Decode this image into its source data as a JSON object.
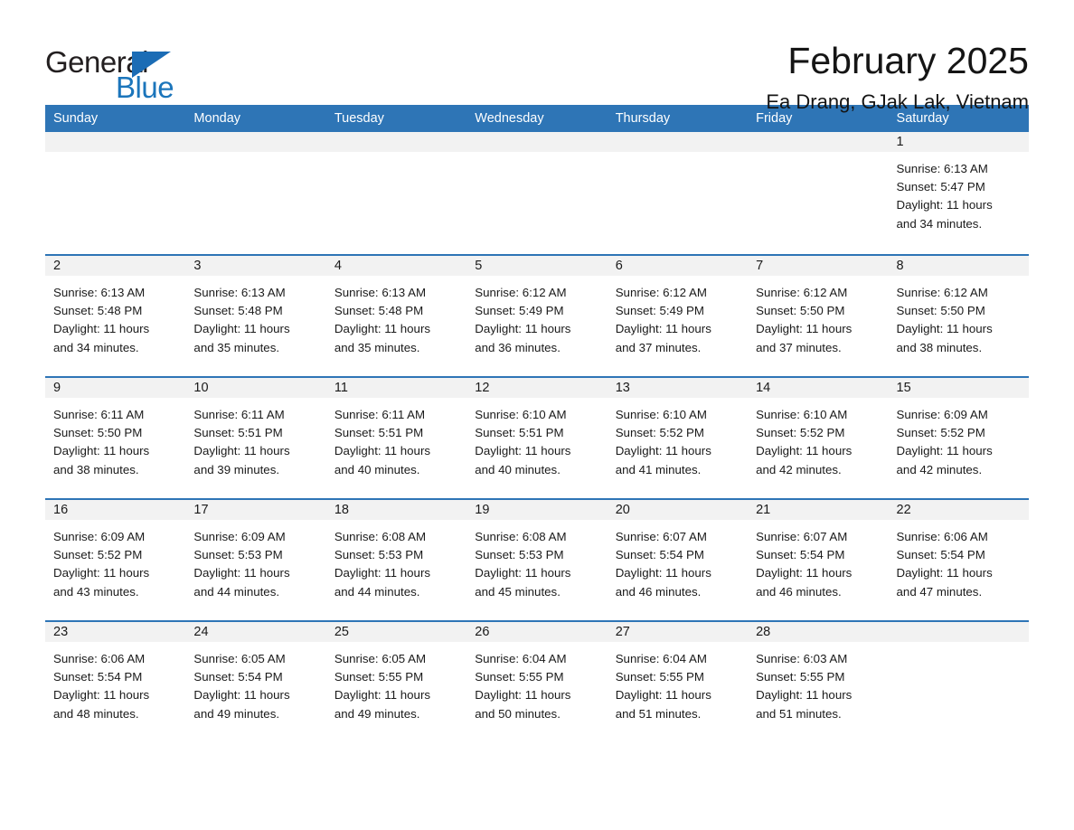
{
  "logo": {
    "word_one": "General",
    "word_two": "Blue",
    "triangle_icon": "triangle-icon"
  },
  "header": {
    "month_title": "February 2025",
    "location": "Ea Drang, GJak Lak, Vietnam"
  },
  "colors": {
    "header_blue": "#2e75b6",
    "logo_blue": "#1b75bb",
    "day_band_gray": "#f2f2f2",
    "text": "#1a1a1a"
  },
  "calendar": {
    "weekdays": [
      "Sunday",
      "Monday",
      "Tuesday",
      "Wednesday",
      "Thursday",
      "Friday",
      "Saturday"
    ],
    "weeks": [
      [
        {
          "day": "",
          "lines": []
        },
        {
          "day": "",
          "lines": []
        },
        {
          "day": "",
          "lines": []
        },
        {
          "day": "",
          "lines": []
        },
        {
          "day": "",
          "lines": []
        },
        {
          "day": "",
          "lines": []
        },
        {
          "day": "1",
          "lines": [
            "Sunrise: 6:13 AM",
            "Sunset: 5:47 PM",
            "Daylight: 11 hours",
            "and 34 minutes."
          ]
        }
      ],
      [
        {
          "day": "2",
          "lines": [
            "Sunrise: 6:13 AM",
            "Sunset: 5:48 PM",
            "Daylight: 11 hours",
            "and 34 minutes."
          ]
        },
        {
          "day": "3",
          "lines": [
            "Sunrise: 6:13 AM",
            "Sunset: 5:48 PM",
            "Daylight: 11 hours",
            "and 35 minutes."
          ]
        },
        {
          "day": "4",
          "lines": [
            "Sunrise: 6:13 AM",
            "Sunset: 5:48 PM",
            "Daylight: 11 hours",
            "and 35 minutes."
          ]
        },
        {
          "day": "5",
          "lines": [
            "Sunrise: 6:12 AM",
            "Sunset: 5:49 PM",
            "Daylight: 11 hours",
            "and 36 minutes."
          ]
        },
        {
          "day": "6",
          "lines": [
            "Sunrise: 6:12 AM",
            "Sunset: 5:49 PM",
            "Daylight: 11 hours",
            "and 37 minutes."
          ]
        },
        {
          "day": "7",
          "lines": [
            "Sunrise: 6:12 AM",
            "Sunset: 5:50 PM",
            "Daylight: 11 hours",
            "and 37 minutes."
          ]
        },
        {
          "day": "8",
          "lines": [
            "Sunrise: 6:12 AM",
            "Sunset: 5:50 PM",
            "Daylight: 11 hours",
            "and 38 minutes."
          ]
        }
      ],
      [
        {
          "day": "9",
          "lines": [
            "Sunrise: 6:11 AM",
            "Sunset: 5:50 PM",
            "Daylight: 11 hours",
            "and 38 minutes."
          ]
        },
        {
          "day": "10",
          "lines": [
            "Sunrise: 6:11 AM",
            "Sunset: 5:51 PM",
            "Daylight: 11 hours",
            "and 39 minutes."
          ]
        },
        {
          "day": "11",
          "lines": [
            "Sunrise: 6:11 AM",
            "Sunset: 5:51 PM",
            "Daylight: 11 hours",
            "and 40 minutes."
          ]
        },
        {
          "day": "12",
          "lines": [
            "Sunrise: 6:10 AM",
            "Sunset: 5:51 PM",
            "Daylight: 11 hours",
            "and 40 minutes."
          ]
        },
        {
          "day": "13",
          "lines": [
            "Sunrise: 6:10 AM",
            "Sunset: 5:52 PM",
            "Daylight: 11 hours",
            "and 41 minutes."
          ]
        },
        {
          "day": "14",
          "lines": [
            "Sunrise: 6:10 AM",
            "Sunset: 5:52 PM",
            "Daylight: 11 hours",
            "and 42 minutes."
          ]
        },
        {
          "day": "15",
          "lines": [
            "Sunrise: 6:09 AM",
            "Sunset: 5:52 PM",
            "Daylight: 11 hours",
            "and 42 minutes."
          ]
        }
      ],
      [
        {
          "day": "16",
          "lines": [
            "Sunrise: 6:09 AM",
            "Sunset: 5:52 PM",
            "Daylight: 11 hours",
            "and 43 minutes."
          ]
        },
        {
          "day": "17",
          "lines": [
            "Sunrise: 6:09 AM",
            "Sunset: 5:53 PM",
            "Daylight: 11 hours",
            "and 44 minutes."
          ]
        },
        {
          "day": "18",
          "lines": [
            "Sunrise: 6:08 AM",
            "Sunset: 5:53 PM",
            "Daylight: 11 hours",
            "and 44 minutes."
          ]
        },
        {
          "day": "19",
          "lines": [
            "Sunrise: 6:08 AM",
            "Sunset: 5:53 PM",
            "Daylight: 11 hours",
            "and 45 minutes."
          ]
        },
        {
          "day": "20",
          "lines": [
            "Sunrise: 6:07 AM",
            "Sunset: 5:54 PM",
            "Daylight: 11 hours",
            "and 46 minutes."
          ]
        },
        {
          "day": "21",
          "lines": [
            "Sunrise: 6:07 AM",
            "Sunset: 5:54 PM",
            "Daylight: 11 hours",
            "and 46 minutes."
          ]
        },
        {
          "day": "22",
          "lines": [
            "Sunrise: 6:06 AM",
            "Sunset: 5:54 PM",
            "Daylight: 11 hours",
            "and 47 minutes."
          ]
        }
      ],
      [
        {
          "day": "23",
          "lines": [
            "Sunrise: 6:06 AM",
            "Sunset: 5:54 PM",
            "Daylight: 11 hours",
            "and 48 minutes."
          ]
        },
        {
          "day": "24",
          "lines": [
            "Sunrise: 6:05 AM",
            "Sunset: 5:54 PM",
            "Daylight: 11 hours",
            "and 49 minutes."
          ]
        },
        {
          "day": "25",
          "lines": [
            "Sunrise: 6:05 AM",
            "Sunset: 5:55 PM",
            "Daylight: 11 hours",
            "and 49 minutes."
          ]
        },
        {
          "day": "26",
          "lines": [
            "Sunrise: 6:04 AM",
            "Sunset: 5:55 PM",
            "Daylight: 11 hours",
            "and 50 minutes."
          ]
        },
        {
          "day": "27",
          "lines": [
            "Sunrise: 6:04 AM",
            "Sunset: 5:55 PM",
            "Daylight: 11 hours",
            "and 51 minutes."
          ]
        },
        {
          "day": "28",
          "lines": [
            "Sunrise: 6:03 AM",
            "Sunset: 5:55 PM",
            "Daylight: 11 hours",
            "and 51 minutes."
          ]
        },
        {
          "day": "",
          "lines": []
        }
      ]
    ]
  }
}
